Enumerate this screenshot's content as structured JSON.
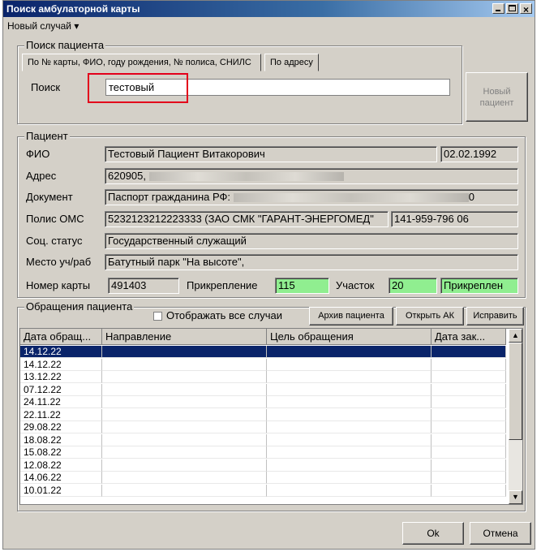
{
  "window": {
    "title": "Поиск амбулаторной карты"
  },
  "menu": {
    "new_case": "Новый случай ▾"
  },
  "search": {
    "group_title": "Поиск пациента",
    "tab_main": "По № карты, ФИО, году рождения, № полиса, СНИЛС",
    "tab_address": "По адресу",
    "label": "Поиск",
    "value": "тестовый",
    "new_patient_line1": "Новый",
    "new_patient_line2": "пациент"
  },
  "patient": {
    "group_title": "Пациент",
    "fio_label": "ФИО",
    "fio": "Тестовый Пациент Витакорович",
    "birth_date": "02.02.1992",
    "address_label": "Адрес",
    "address_prefix": "620905,",
    "document_label": "Документ",
    "document_prefix": "Паспорт гражданина РФ:",
    "document_suffix": "0",
    "oms_label": "Полис ОМС",
    "oms": "5232123212223333 (ЗАО СМК \"ГАРАНТ-ЭНЕРГОМЕД\"",
    "snils": "141-959-796 06",
    "social_label": "Соц. статус",
    "social": "Государственный служащий",
    "work_label": "Место уч/раб",
    "work": "Батутный парк \"На высоте\",",
    "card_label": "Номер карты",
    "card": "491403",
    "attach_label": "Прикрепление",
    "attach": "115",
    "district_label": "Участок",
    "district": "20",
    "status": "Прикреплен"
  },
  "visits": {
    "group_title": "Обращения пациента",
    "show_all": "Отображать все случаи",
    "archive_button": "Архив пациента",
    "open_ak_button": "Открыть АК",
    "edit_button": "Исправить",
    "columns": [
      "Дата обращ...",
      "Направление",
      "Цель обращения",
      "Дата зак..."
    ],
    "rows": [
      "14.12.22",
      "14.12.22",
      "13.12.22",
      "07.12.22",
      "24.11.22",
      "22.11.22",
      "29.08.22",
      "18.08.22",
      "15.08.22",
      "12.08.22",
      "14.06.22",
      "10.01.22"
    ]
  },
  "footer": {
    "ok": "Ok",
    "cancel": "Отмена"
  },
  "colors": {
    "title_bar": "#0a246a",
    "selection": "#0a246a",
    "highlight": "#e3001b",
    "green_field": "#90ee90"
  }
}
